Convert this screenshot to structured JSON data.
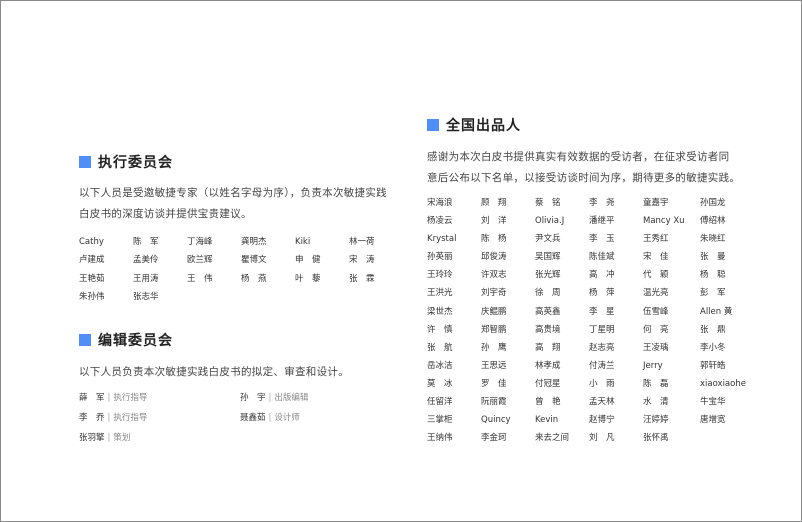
{
  "exec_committee": {
    "title": "执行委员会",
    "description_line1": "以下人员是受邀敏捷专家（以姓名字母为序），负责本次敏捷实践",
    "description_line2": "白皮书的深度访谈并提供宝贵建议。",
    "members": [
      "Cathy",
      "陈　军",
      "丁海峰",
      "龚明杰",
      "Kiki",
      "林一荷",
      "卢建成",
      "孟美伶",
      "欧兰辉",
      "瞿博文",
      "申　健",
      "宋　涛",
      "王艳茹",
      "王用涛",
      "王　伟",
      "杨　燕",
      "叶　藜",
      "张　霖",
      "朱孙伟",
      "张志华"
    ]
  },
  "editorial_committee": {
    "title": "编辑委员会",
    "description": "以下人员负责本次敏捷实践白皮书的拟定、审查和设计。",
    "members": [
      {
        "name": "薛　军",
        "role": "执行指导"
      },
      {
        "name": "孙　宇",
        "role": "出版编辑"
      },
      {
        "name": "李　乔",
        "role": "执行指导"
      },
      {
        "name": "聂鑫茹",
        "role": "设计师"
      },
      {
        "name": "张羽擎",
        "role": "策划"
      }
    ],
    "separator": "|"
  },
  "national_producers": {
    "title": "全国出品人",
    "description_line1": "感谢为本次白皮书提供真实有效数据的受访者，在征求受访者同",
    "description_line2": "意后公布以下名单，以接受访谈时间为序，期待更多的敏捷实践。",
    "members": [
      "宋海浪",
      "顾　翔",
      "蔡　铭",
      "李　尧",
      "童嘉宇",
      "孙国龙",
      "杨凌云",
      "刘　洋",
      "Olivia.J",
      "潘继平",
      "Mancy Xu",
      "傅绍林",
      "Krystal",
      "陈　杨",
      "尹文兵",
      "李　玉",
      "王秀红",
      "朱晓红",
      "孙英丽",
      "邱俊涛",
      "吴国辉",
      "陈佳斌",
      "宋　佳",
      "张　曼",
      "王玲玲",
      "许双志",
      "张光辉",
      "高　冲",
      "代　颖",
      "杨　聪",
      "王洪光",
      "刘宇奇",
      "徐　周",
      "杨　萍",
      "温光亮",
      "彭　军",
      "梁世杰",
      "庆鲲鹏",
      "高英鑫",
      "李　星",
      "伍雪峰",
      "Allen 黄",
      "许　慎",
      "郑智鹏",
      "高贵境",
      "丁星明",
      "何　亮",
      "张　鼎",
      "张　航",
      "孙　鹰",
      "高　翔",
      "赵志亮",
      "王凌瑀",
      "李小冬",
      "岳冰洁",
      "王思远",
      "林孝成",
      "付涛兰",
      "Jerry",
      "郭轩皓",
      "莫　冰",
      "罗　佳",
      "付冠星",
      "小　雨",
      "陈　磊",
      "xiaoxiaohe",
      "任留洋",
      "阮丽霞",
      "曾　艳",
      "孟天林",
      "水　清",
      "牛宝华",
      "三掌柜",
      "Quincy",
      "Kevin",
      "赵博宁",
      "汪婷婷",
      "唐增宽",
      "王纳伟",
      "李金珂",
      "来去之间",
      "刘　凡",
      "张怀禹"
    ]
  },
  "colors": {
    "accent": "#4f8ef7",
    "heading": "#222222",
    "body_text": "#444444",
    "role_text": "#888888",
    "page_border": "#8a8a8a"
  }
}
